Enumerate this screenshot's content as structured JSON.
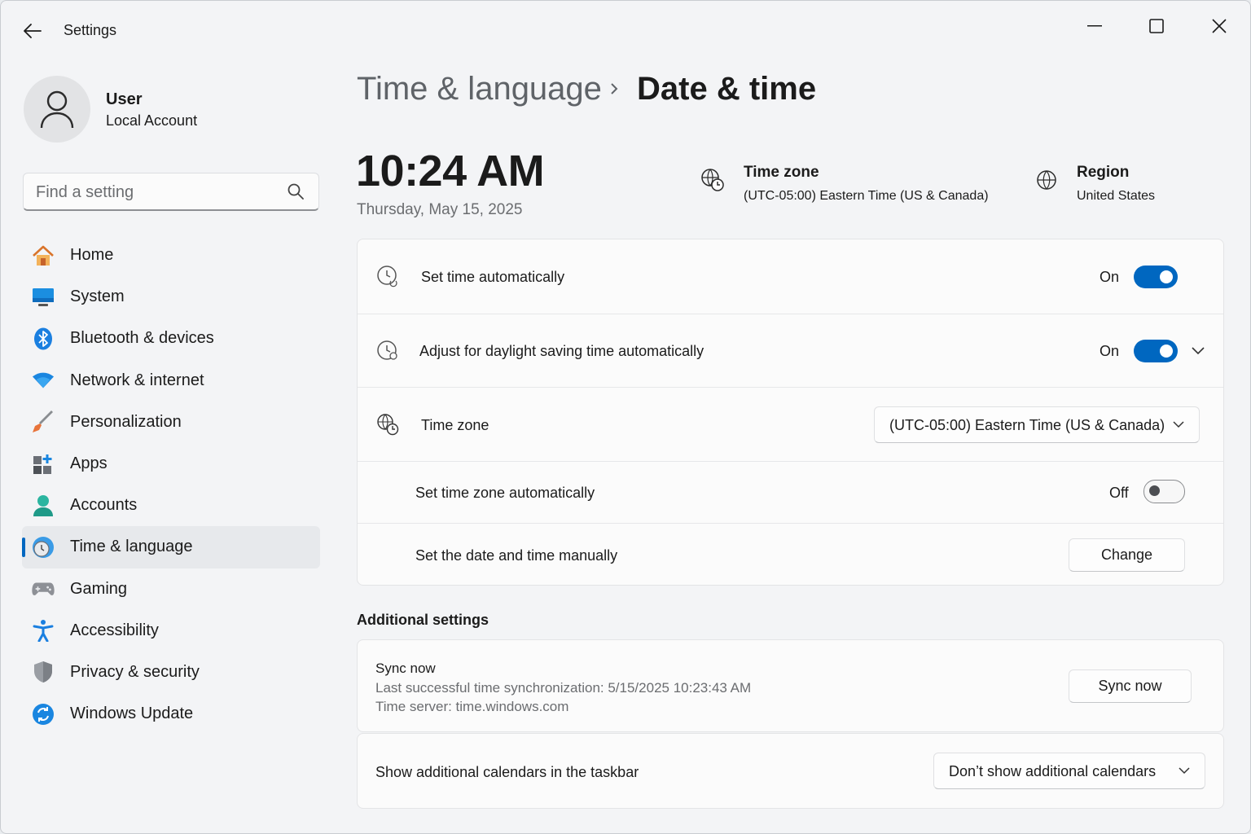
{
  "window": {
    "title": "Settings",
    "icons": {
      "back": "back-arrow-icon",
      "minimize": "minimize-icon",
      "maximize": "maximize-icon",
      "close": "close-icon"
    }
  },
  "profile": {
    "name": "User",
    "account_type": "Local Account",
    "icon": "person-icon"
  },
  "search": {
    "placeholder": "Find a setting",
    "value": "",
    "icon": "search-icon"
  },
  "nav": {
    "items": [
      {
        "label": "Home",
        "icon": "home-icon",
        "active": false
      },
      {
        "label": "System",
        "icon": "monitor-icon",
        "active": false
      },
      {
        "label": "Bluetooth & devices",
        "icon": "bluetooth-icon",
        "active": false
      },
      {
        "label": "Network & internet",
        "icon": "wifi-icon",
        "active": false
      },
      {
        "label": "Personalization",
        "icon": "brush-icon",
        "active": false
      },
      {
        "label": "Apps",
        "icon": "apps-icon",
        "active": false
      },
      {
        "label": "Accounts",
        "icon": "accounts-icon",
        "active": false
      },
      {
        "label": "Time & language",
        "icon": "clock-globe-icon",
        "active": true
      },
      {
        "label": "Gaming",
        "icon": "gamepad-icon",
        "active": false
      },
      {
        "label": "Accessibility",
        "icon": "accessibility-icon",
        "active": false
      },
      {
        "label": "Privacy & security",
        "icon": "shield-icon",
        "active": false
      },
      {
        "label": "Windows Update",
        "icon": "update-icon",
        "active": false
      }
    ]
  },
  "breadcrumb": {
    "parent": "Time & language",
    "separator_icon": "chevron-right-icon",
    "current": "Date & time"
  },
  "clock": {
    "time": "10:24 AM",
    "date": "Thursday, May 15, 2025"
  },
  "summary": {
    "timezone": {
      "title": "Time zone",
      "value": "(UTC-05:00) Eastern Time (US & Canada)",
      "icon": "timezone-icon"
    },
    "region": {
      "title": "Region",
      "value": "United States",
      "icon": "globe-icon"
    }
  },
  "settings": {
    "set_time_auto": {
      "label": "Set time automatically",
      "state_label": "On",
      "on": true,
      "icon": "clock-sync-icon"
    },
    "daylight_saving": {
      "label": "Adjust for daylight saving time automatically",
      "state_label": "On",
      "on": true,
      "icon": "clock-refresh-icon",
      "expand_icon": "chevron-down-icon"
    },
    "time_zone": {
      "label": "Time zone",
      "selected": "(UTC-05:00) Eastern Time (US & Canada)",
      "icon": "timezone-icon"
    },
    "set_timezone_auto": {
      "label": "Set time zone automatically",
      "state_label": "Off",
      "on": false
    },
    "manual": {
      "label": "Set the date and time manually",
      "button": "Change"
    }
  },
  "additional": {
    "title": "Additional settings",
    "sync": {
      "label": "Sync now",
      "last_sync": "Last successful time synchronization: 5/15/2025 10:23:43 AM",
      "server": "Time server: time.windows.com",
      "button": "Sync now"
    },
    "calendars": {
      "label": "Show additional calendars in the taskbar",
      "selected": "Don’t show additional calendars"
    }
  },
  "colors": {
    "accent": "#0067c0",
    "background": "#f3f4f6",
    "card": "#fbfbfb"
  }
}
